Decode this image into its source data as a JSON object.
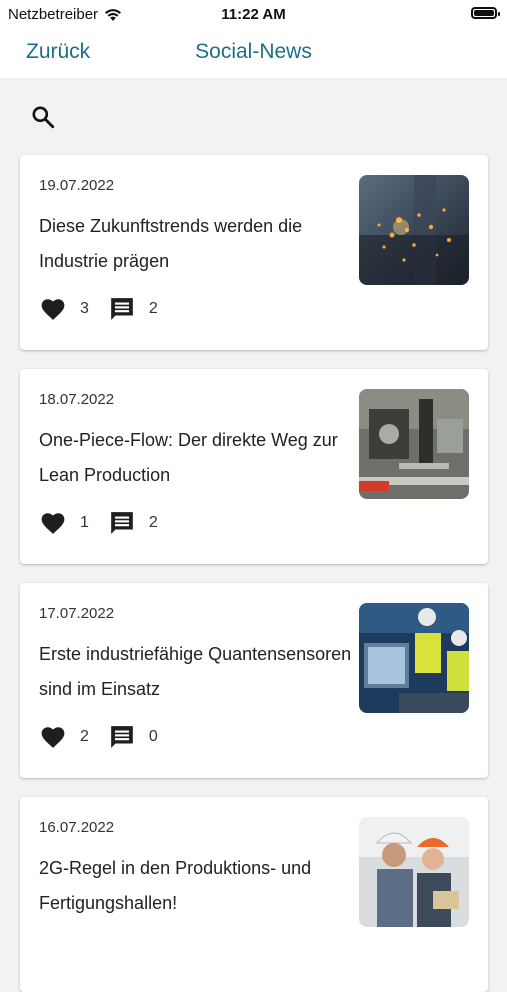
{
  "status_bar": {
    "carrier": "Netzbetreiber",
    "time": "11:22 AM"
  },
  "nav": {
    "back_label": "Zurück",
    "title": "Social-News"
  },
  "colors": {
    "accent": "#1f6e87",
    "background": "#f2f2f2",
    "card": "#ffffff"
  },
  "articles": [
    {
      "date": "19.07.2022",
      "title": "Diese Zukunftstrends werden die Industrie prägen",
      "likes": "3",
      "comments": "2",
      "image": "welding-sparks-image"
    },
    {
      "date": "18.07.2022",
      "title": "One-Piece-Flow: Der direkte Weg zur Lean Production",
      "likes": "1",
      "comments": "2",
      "image": "machinery-image"
    },
    {
      "date": "17.07.2022",
      "title": "Erste industriefähige Quantensensoren sind im Einsatz",
      "likes": "2",
      "comments": "0",
      "image": "engineers-workstation-image"
    },
    {
      "date": "16.07.2022",
      "title": "2G-Regel in den Produktions- und Fertigungshallen!",
      "likes": "",
      "comments": "",
      "image": "workers-hardhats-image"
    }
  ]
}
